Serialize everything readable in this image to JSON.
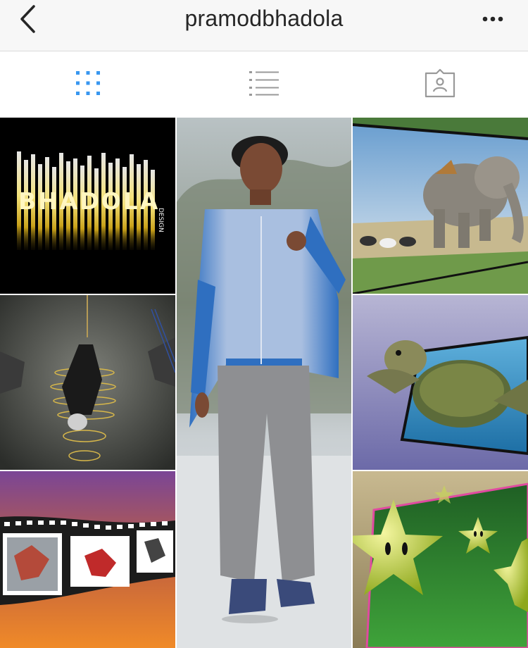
{
  "header": {
    "username": "pramodbhadola",
    "back_icon": "chevron-left-icon",
    "more_icon": "ellipsis-horizontal-icon"
  },
  "tabs": [
    {
      "name": "grid-view",
      "icon": "grid-icon",
      "active": true
    },
    {
      "name": "list-view",
      "icon": "list-icon",
      "active": false
    },
    {
      "name": "tagged",
      "icon": "tagged-person-icon",
      "active": false
    }
  ],
  "colors": {
    "accent": "#3897f0",
    "icon_gray": "#999999",
    "text": "#262626",
    "header_bg": "#f7f7f7"
  },
  "posts": [
    {
      "description": "bhadola-design-logo",
      "logo_text": "BHADOLA",
      "logo_sub": "DESIGN"
    },
    {
      "description": "portrait-man-blue-hoodie"
    },
    {
      "description": "elephant-popping-out-frame"
    },
    {
      "description": "breakdancers-with-ropes"
    },
    {
      "description": "sea-turtle-out-of-frame"
    },
    {
      "description": "dancers-on-filmstrip"
    },
    {
      "description": "green-stars-3d"
    }
  ]
}
